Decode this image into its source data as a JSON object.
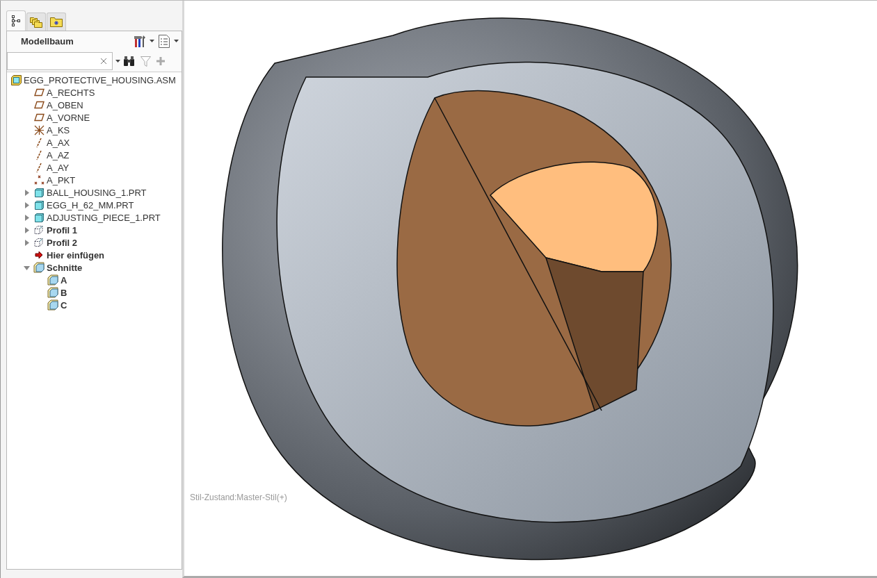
{
  "panel_tabs": [
    {
      "kind": "tree",
      "selected": true
    },
    {
      "kind": "layers",
      "selected": false
    },
    {
      "kind": "favorites",
      "selected": false
    }
  ],
  "model_tree": {
    "title": "Modellbaum",
    "root": {
      "label": "EGG_PROTECTIVE_HOUSING.ASM",
      "kind": "assembly",
      "children": [
        {
          "label": "A_RECHTS",
          "kind": "plane"
        },
        {
          "label": "A_OBEN",
          "kind": "plane"
        },
        {
          "label": "A_VORNE",
          "kind": "plane"
        },
        {
          "label": "A_KS",
          "kind": "csys"
        },
        {
          "label": "A_AX",
          "kind": "axis"
        },
        {
          "label": "A_AZ",
          "kind": "axis"
        },
        {
          "label": "A_AY",
          "kind": "axis"
        },
        {
          "label": "A_PKT",
          "kind": "point"
        },
        {
          "label": "BALL_HOUSING_1.PRT",
          "kind": "part",
          "expanded": false
        },
        {
          "label": "EGG_H_62_MM.PRT",
          "kind": "part",
          "expanded": false
        },
        {
          "label": "ADJUSTING_PIECE_1.PRT",
          "kind": "part",
          "expanded": false
        },
        {
          "label": "Profil 1",
          "kind": "profile",
          "expanded": false
        },
        {
          "label": "Profil 2",
          "kind": "profile",
          "expanded": false
        },
        {
          "label": "Hier einfügen",
          "kind": "insert"
        },
        {
          "label": "Schnitte",
          "kind": "sections",
          "expanded": true,
          "children": [
            {
              "label": "A",
              "kind": "section"
            },
            {
              "label": "B",
              "kind": "section"
            },
            {
              "label": "C",
              "kind": "section"
            }
          ]
        }
      ]
    }
  },
  "viewport": {
    "status": "Stil-Zustand:Master-Stil(+)"
  }
}
